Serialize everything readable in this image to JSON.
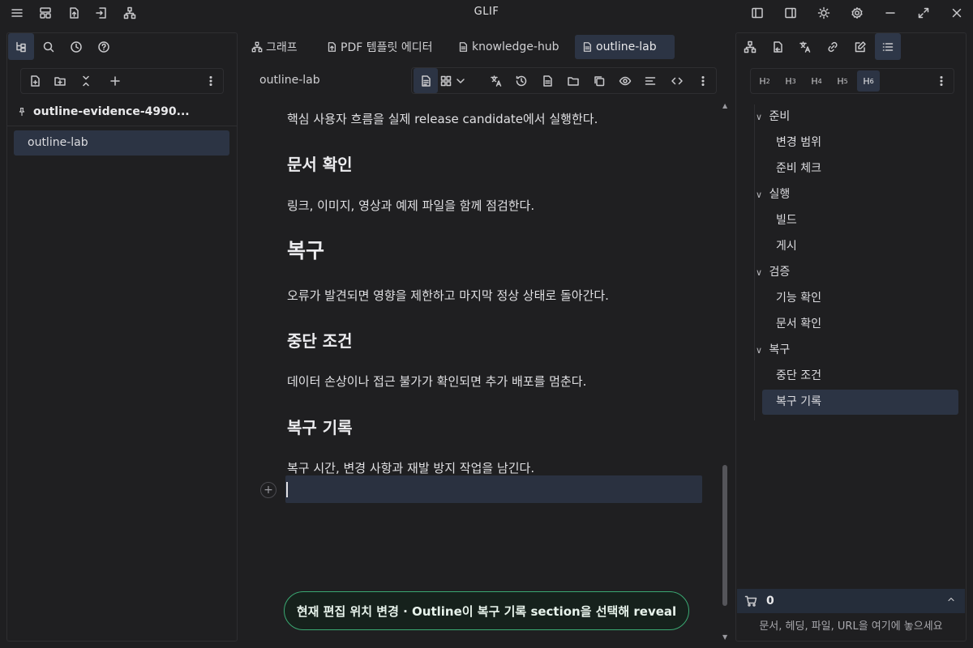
{
  "app": {
    "title": "GLIF"
  },
  "titlebar": {
    "left_icons": [
      "menu-icon",
      "layout-icon",
      "export-icon",
      "import-icon",
      "graph-icon"
    ],
    "right_icons": [
      "left-sidebar-toggle-icon",
      "right-sidebar-toggle-icon",
      "theme-icon",
      "settings-icon",
      "minimize-icon",
      "maximize-icon",
      "close-icon"
    ]
  },
  "left_panel": {
    "tabs": [
      "file-tree-icon",
      "search-icon",
      "history-icon",
      "help-icon"
    ],
    "toolbar_icons": [
      "new-file-icon",
      "new-folder-icon",
      "collapse-icon",
      "add-icon",
      "more-icon"
    ],
    "notebook": "outline-evidence-4990...",
    "documents": [
      {
        "label": "outline-lab",
        "selected": true
      }
    ]
  },
  "center": {
    "tabs": [
      {
        "label": "그래프",
        "icon": "graph-icon"
      },
      {
        "label": "PDF 템플릿 에디터",
        "icon": "pdf-icon"
      },
      {
        "label": "knowledge-hub",
        "icon": "doc-icon"
      },
      {
        "label": "outline-lab",
        "icon": "doc-icon",
        "active": true
      }
    ],
    "doc_title": "outline-lab",
    "toolbar_icons": [
      "document-icon",
      "grid-icon",
      "chevron-down-icon",
      "translate-icon",
      "history-icon",
      "file-icon",
      "folder-icon",
      "copy-icon",
      "preview-icon",
      "align-icon",
      "code-icon",
      "more-icon"
    ],
    "blocks": [
      {
        "type": "p",
        "text": "핵심 사용자 흐름을 실제 release candidate에서 실행한다."
      },
      {
        "type": "h3",
        "text": "문서 확인"
      },
      {
        "type": "p",
        "text": "링크, 이미지, 영상과 예제 파일을 함께 점검한다."
      },
      {
        "type": "h2",
        "text": "복구"
      },
      {
        "type": "p",
        "text": "오류가 발견되면 영향을 제한하고 마지막 정상 상태로 돌아간다."
      },
      {
        "type": "h3",
        "text": "중단 조건"
      },
      {
        "type": "p",
        "text": "데이터 손상이나 접근 불가가 확인되면 추가 배포를 멈춘다."
      },
      {
        "type": "h3",
        "text": "복구 기록"
      },
      {
        "type": "p",
        "text": "복구 시간, 변경 사항과 재발 방지 작업을 남긴다."
      }
    ],
    "toast": "현재 편집 위치 변경 · Outline이 복구 기록 section을 선택해 reveal"
  },
  "right_panel": {
    "tabs": [
      "graph-icon",
      "backlink-icon",
      "translate-icon",
      "link-icon",
      "edit-icon",
      "outline-list-icon"
    ],
    "heading_levels": [
      {
        "label": "H",
        "sub": "2"
      },
      {
        "label": "H",
        "sub": "3"
      },
      {
        "label": "H",
        "sub": "4"
      },
      {
        "label": "H",
        "sub": "5"
      },
      {
        "label": "H",
        "sub": "6",
        "active": true
      }
    ],
    "outline": [
      {
        "label": "준비",
        "level": 1
      },
      {
        "label": "변경 범위",
        "level": 2
      },
      {
        "label": "준비 체크",
        "level": 2
      },
      {
        "label": "실행",
        "level": 1
      },
      {
        "label": "빌드",
        "level": 2
      },
      {
        "label": "게시",
        "level": 2
      },
      {
        "label": "검증",
        "level": 1
      },
      {
        "label": "기능 확인",
        "level": 2
      },
      {
        "label": "문서 확인",
        "level": 2
      },
      {
        "label": "복구",
        "level": 1
      },
      {
        "label": "중단 조건",
        "level": 2
      },
      {
        "label": "복구 기록",
        "level": 2,
        "selected": true
      }
    ],
    "cart": {
      "count": "0",
      "icon": "cart-icon"
    },
    "drop_hint": "문서, 헤딩, 파일, URL을 여기에 놓으세요"
  }
}
